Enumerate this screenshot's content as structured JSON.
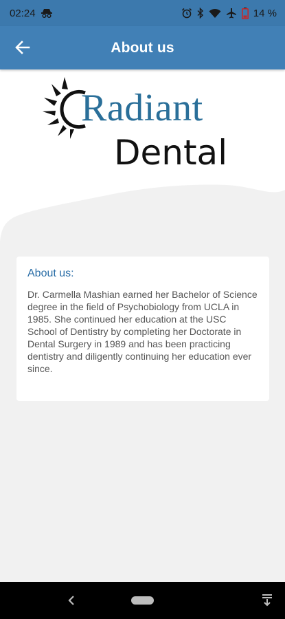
{
  "status_bar": {
    "time": "02:24",
    "battery_percent": "14 %",
    "icons": [
      "incognito-icon",
      "alarm-icon",
      "bluetooth-icon",
      "wifi-icon",
      "airplane-icon",
      "battery-low-icon"
    ]
  },
  "app_bar": {
    "back_icon": "arrow-left-icon",
    "title": "About us"
  },
  "logo": {
    "line1": "Radiant",
    "line2": "Dental",
    "sun_icon": "sun-icon"
  },
  "about_card": {
    "heading": "About us:",
    "body": "Dr. Carmella Mashian earned her Bachelor of Science degree in the field of Psychobiology from UCLA in 1985. She continued her education at the USC School of Dentistry by completing her Doctorate in Dental Surgery in 1989 and has been practicing dentistry and diligently continuing her education ever since."
  },
  "nav_bar": {
    "icons": [
      "nav-back-icon",
      "nav-home-pill",
      "nav-extra-icon"
    ]
  },
  "colors": {
    "status_bar": "#3c79ad",
    "app_bar": "#4180b6",
    "logo_blue": "#2a6f99",
    "heading_blue": "#2b6ea7",
    "background": "#f1f1f1"
  }
}
